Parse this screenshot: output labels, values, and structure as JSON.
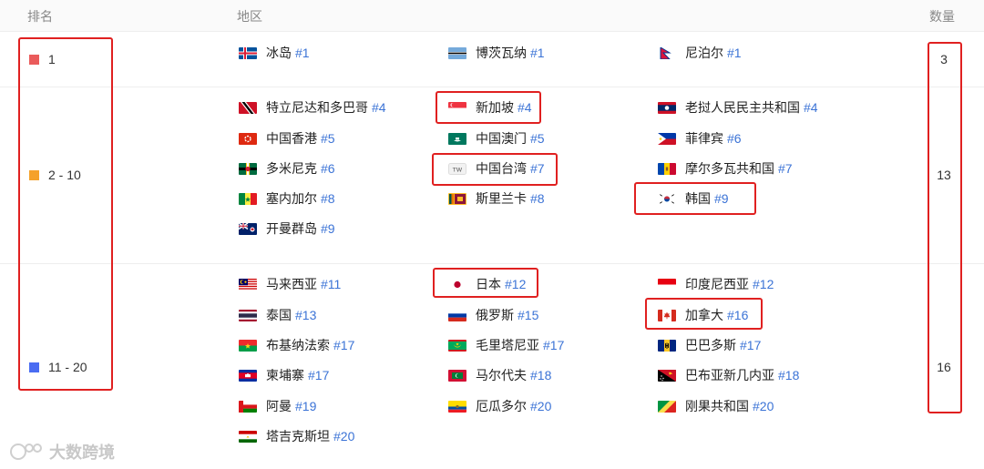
{
  "header": {
    "rank_label": "排名",
    "region_label": "地区",
    "count_label": "数量"
  },
  "colors": {
    "tier1": "#ea5b5b",
    "tier2": "#f5a12a",
    "tier3": "#4a6cf2",
    "link": "#3b73d6",
    "highlight": "#e02020"
  },
  "groups": [
    {
      "rank": "1",
      "count": "3",
      "items": [
        {
          "name": "冰岛",
          "pos": "#1",
          "flag": "iceland-flag"
        },
        {
          "name": "博茨瓦纳",
          "pos": "#1",
          "flag": "botswana-flag"
        },
        {
          "name": "尼泊尔",
          "pos": "#1",
          "flag": "nepal-flag"
        }
      ]
    },
    {
      "rank": "2 - 10",
      "count": "13",
      "items": [
        {
          "name": "特立尼达和多巴哥",
          "pos": "#4",
          "flag": "trinidad-flag"
        },
        {
          "name": "新加坡",
          "pos": "#4",
          "flag": "singapore-flag"
        },
        {
          "name": "老挝人民民主共和国",
          "pos": "#4",
          "flag": "laos-flag"
        },
        {
          "name": "中国香港",
          "pos": "#5",
          "flag": "hongkong-flag"
        },
        {
          "name": "中国澳门",
          "pos": "#5",
          "flag": "macau-flag"
        },
        {
          "name": "菲律宾",
          "pos": "#6",
          "flag": "philippines-flag"
        },
        {
          "name": "多米尼克",
          "pos": "#6",
          "flag": "dominica-flag"
        },
        {
          "name": "中国台湾",
          "pos": "#7",
          "flag": "tw-badge",
          "badge_text": "TW"
        },
        {
          "name": "摩尔多瓦共和国",
          "pos": "#7",
          "flag": "moldova-flag"
        },
        {
          "name": "塞内加尔",
          "pos": "#8",
          "flag": "senegal-flag"
        },
        {
          "name": "斯里兰卡",
          "pos": "#8",
          "flag": "srilanka-flag"
        },
        {
          "name": "韩国",
          "pos": "#9",
          "flag": "korea-flag"
        },
        {
          "name": "开曼群岛",
          "pos": "#9",
          "flag": "cayman-flag"
        }
      ]
    },
    {
      "rank": "11 - 20",
      "count": "16",
      "items": [
        {
          "name": "马来西亚",
          "pos": "#11",
          "flag": "malaysia-flag"
        },
        {
          "name": "日本",
          "pos": "#12",
          "flag": "japan-flag"
        },
        {
          "name": "印度尼西亚",
          "pos": "#12",
          "flag": "indonesia-flag"
        },
        {
          "name": "泰国",
          "pos": "#13",
          "flag": "thailand-flag"
        },
        {
          "name": "俄罗斯",
          "pos": "#15",
          "flag": "russia-flag"
        },
        {
          "name": "加拿大",
          "pos": "#16",
          "flag": "canada-flag"
        },
        {
          "name": "布基纳法索",
          "pos": "#17",
          "flag": "burkina-flag"
        },
        {
          "name": "毛里塔尼亚",
          "pos": "#17",
          "flag": "mauritania-flag"
        },
        {
          "name": "巴巴多斯",
          "pos": "#17",
          "flag": "barbados-flag"
        },
        {
          "name": "柬埔寨",
          "pos": "#17",
          "flag": "cambodia-flag"
        },
        {
          "name": "马尔代夫",
          "pos": "#18",
          "flag": "maldives-flag"
        },
        {
          "name": "巴布亚新几内亚",
          "pos": "#18",
          "flag": "png-flag"
        },
        {
          "name": "阿曼",
          "pos": "#19",
          "flag": "oman-flag"
        },
        {
          "name": "厄瓜多尔",
          "pos": "#20",
          "flag": "ecuador-flag"
        },
        {
          "name": "刚果共和国",
          "pos": "#20",
          "flag": "congo-flag"
        },
        {
          "name": "塔吉克斯坦",
          "pos": "#20",
          "flag": "tajikistan-flag"
        }
      ]
    }
  ],
  "watermark": "大数跨境"
}
